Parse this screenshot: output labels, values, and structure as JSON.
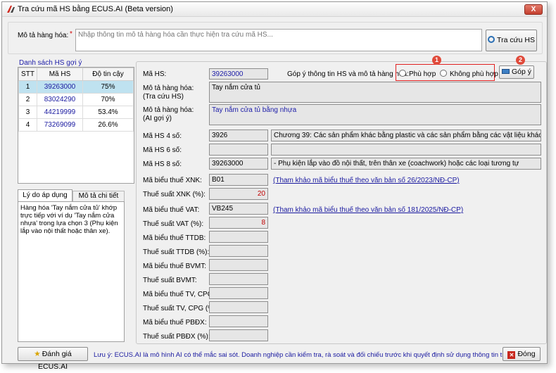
{
  "window": {
    "title": "Tra cứu mã HS bằng ECUS.AI (Beta version)",
    "close": "X"
  },
  "search": {
    "label": "Mô tả hàng hóa:",
    "required_mark": "*",
    "placeholder": "Nhập thông tin mô tả hàng hóa cần thực hiện tra cứu mã HS...",
    "button": "Tra cứu HS"
  },
  "suggest": {
    "title": "Danh sách HS gợi ý",
    "headers": [
      "STT",
      "Mã HS",
      "Độ tin cậy"
    ],
    "rows": [
      {
        "stt": "1",
        "code": "39263000",
        "conf": "75%"
      },
      {
        "stt": "2",
        "code": "83024290",
        "conf": "70%"
      },
      {
        "stt": "3",
        "code": "44219999",
        "conf": "53.4%"
      },
      {
        "stt": "4",
        "code": "73269099",
        "conf": "26.6%"
      }
    ]
  },
  "tabs": {
    "reason": "Lý do áp dụng HS",
    "detail": "Mô tả chi tiết HS",
    "reason_text": "Hàng hóa 'Tay nắm cửa tủ' khớp trực tiếp với ví dụ 'Tay nắm cửa nhựa' trong lựa chọn 3 (Phụ kiện lắp vào nội thất hoặc thân xe)."
  },
  "detail": {
    "ma_hs_label": "Mã HS:",
    "ma_hs": "39263000",
    "feedback_label": "Góp ý thông tin HS và mô tả hàng hóa:",
    "phu_hop": "Phù hợp",
    "khong_phu_hop": "Không phù hợp",
    "gop_y": "Góp ý",
    "badge1": "1",
    "badge2": "2",
    "mo_ta_tra_cuu_label": "Mô tả hàng hóa:",
    "mo_ta_tra_cuu_sub": "(Tra cứu HS)",
    "mo_ta_tra_cuu": "Tay nắm cửa tủ",
    "mo_ta_ai_label": "Mô tả hàng hóa:",
    "mo_ta_ai_sub": "(AI gợi ý)",
    "mo_ta_ai": "Tay nắm cửa tủ bằng nhựa",
    "hs4_label": "Mã HS 4 số:",
    "hs4": "3926",
    "hs4_desc": "Chương 39: Các sản phẩm khác bằng plastic và các sản phẩm bằng các vật liệu khác của các nhó",
    "hs6_label": "Mã HS 6 số:",
    "hs6": "",
    "hs6_desc": "",
    "hs8_label": "Mã HS 8 số:",
    "hs8": "39263000",
    "hs8_desc": "- Phụ kiện lắp vào đồ nội thất, trên thân xe (coachwork) hoặc các loại tương tự",
    "xnk_code_label": "Mã biểu thuế XNK:",
    "xnk_code": "B01",
    "xnk_link": "(Tham khảo mã biểu thuế theo văn bản số 26/2023/NĐ-CP)",
    "xnk_rate_label": "Thuế suất XNK (%):",
    "xnk_rate": "20",
    "vat_code_label": "Mã biểu thuế VAT:",
    "vat_code": "VB245",
    "vat_link": "(Tham khảo mã biểu thuế theo văn bản số 181/2025/NĐ-CP)",
    "vat_rate_label": "Thuế suất VAT (%):",
    "vat_rate": "8",
    "ttdb_code_label": "Mã biểu thuế TTDB:",
    "ttdb_rate_label": "Thuế suất TTDB (%):",
    "bvmt_code_label": "Mã biểu thuế BVMT:",
    "bvmt_rate_label": "Thuế suất BVMT:",
    "tv_code_label": "Mã biểu thuế TV, CPG:",
    "tv_rate_label": "Thuế suất TV, CPG (%):",
    "pbdx_code_label": "Mã biểu thuế PBĐX:",
    "pbdx_rate_label": "Thuế suất PBĐX (%):"
  },
  "footer": {
    "rate_button": "Đánh giá ECUS.AI",
    "note": "Lưu ý: ECUS.AI là mô hình AI có thể mắc sai sót. Doanh nghiệp cần kiểm tra, rà soát và đối chiếu trước khi quyết định sử dụng thông tin trên.",
    "close_button": "Đóng"
  },
  "colors": {
    "highlight": "#e02020",
    "selected_row": "#bfe2f0",
    "link": "#1a1aa0"
  }
}
